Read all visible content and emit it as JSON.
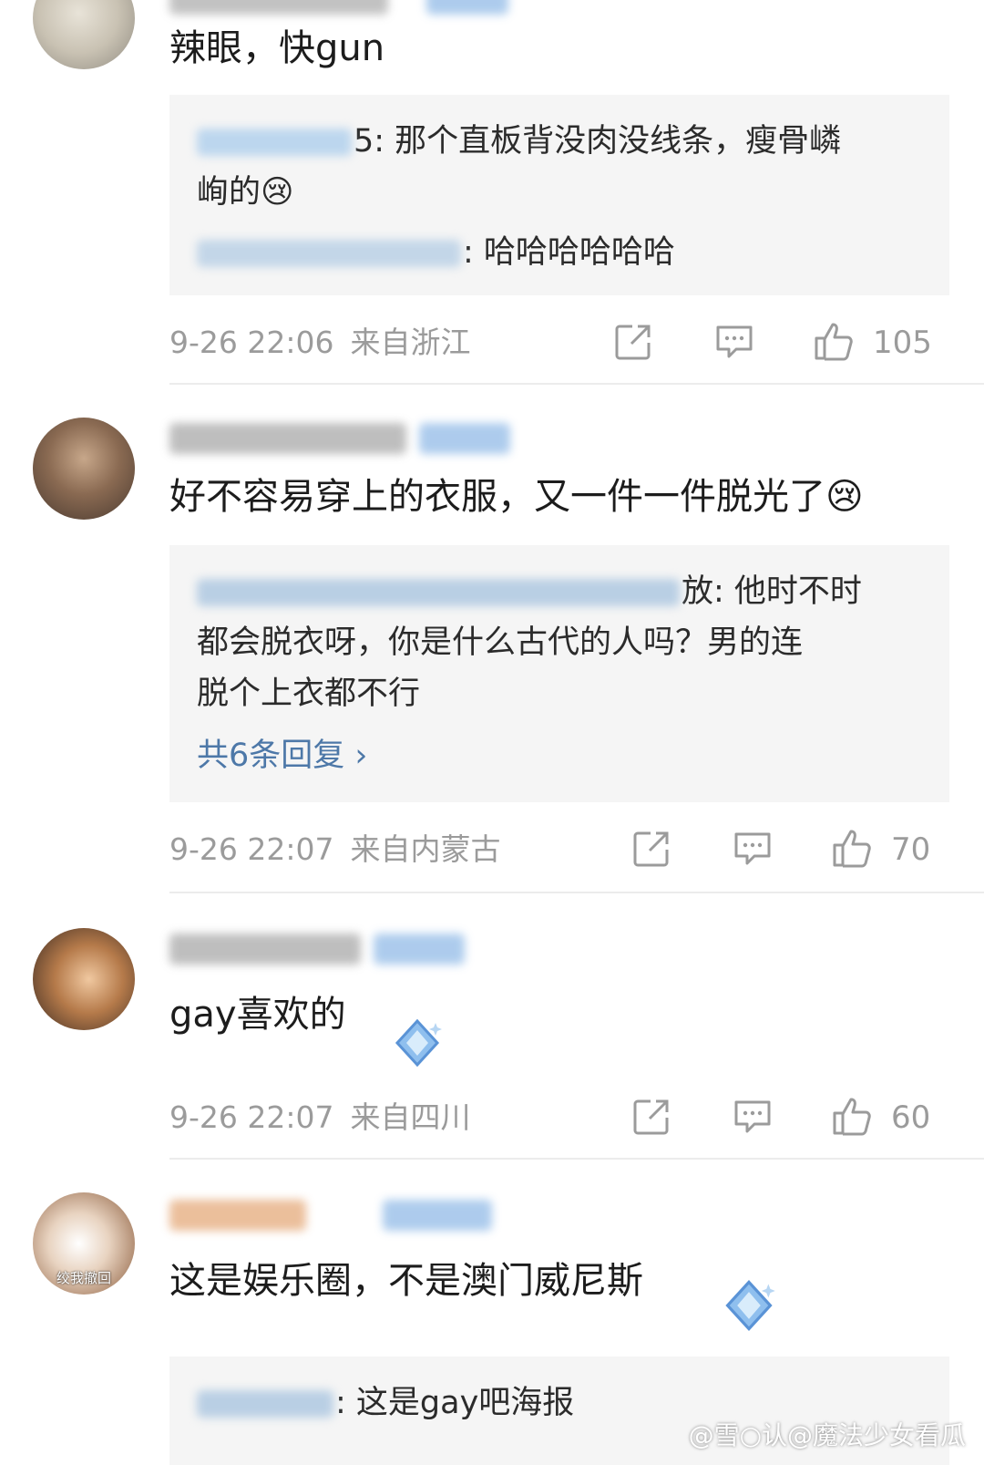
{
  "comments": [
    {
      "text": "辣眼，快gun",
      "replies": [
        {
          "suffix": "5: 那个直板背没肉没线条，瘦骨嶙",
          "cont": "峋的😢"
        },
        {
          "suffix": ": 哈哈哈哈哈哈"
        }
      ],
      "time": "9-26 22:06",
      "location": "来自浙江",
      "likes": "105"
    },
    {
      "text": "好不容易穿上的衣服，又一件一件脱光了😢",
      "replies": [
        {
          "suffix": "放: 他时不时",
          "cont1": "都会脱衣呀，你是什么古代的人吗？男的连",
          "cont2": "脱个上衣都不行"
        }
      ],
      "more": "共6条回复 ›",
      "time": "9-26 22:07",
      "location": "来自内蒙古",
      "likes": "70"
    },
    {
      "text": "gay喜欢的",
      "time": "9-26 22:07",
      "location": "来自四川",
      "likes": "60"
    },
    {
      "text": "这是娱乐圈，不是澳门威尼斯",
      "avatar_tag": "绞我撤回",
      "replies": [
        {
          "suffix": ": 这是gay吧海报"
        }
      ]
    }
  ],
  "watermark": "@雪○认@魔法少女看瓜",
  "icons": [
    "share-icon",
    "comment-icon",
    "like-icon"
  ],
  "colors": {
    "link": "#4d78a8",
    "meta": "#9b9b9b",
    "reply_bg": "#f5f5f5"
  }
}
